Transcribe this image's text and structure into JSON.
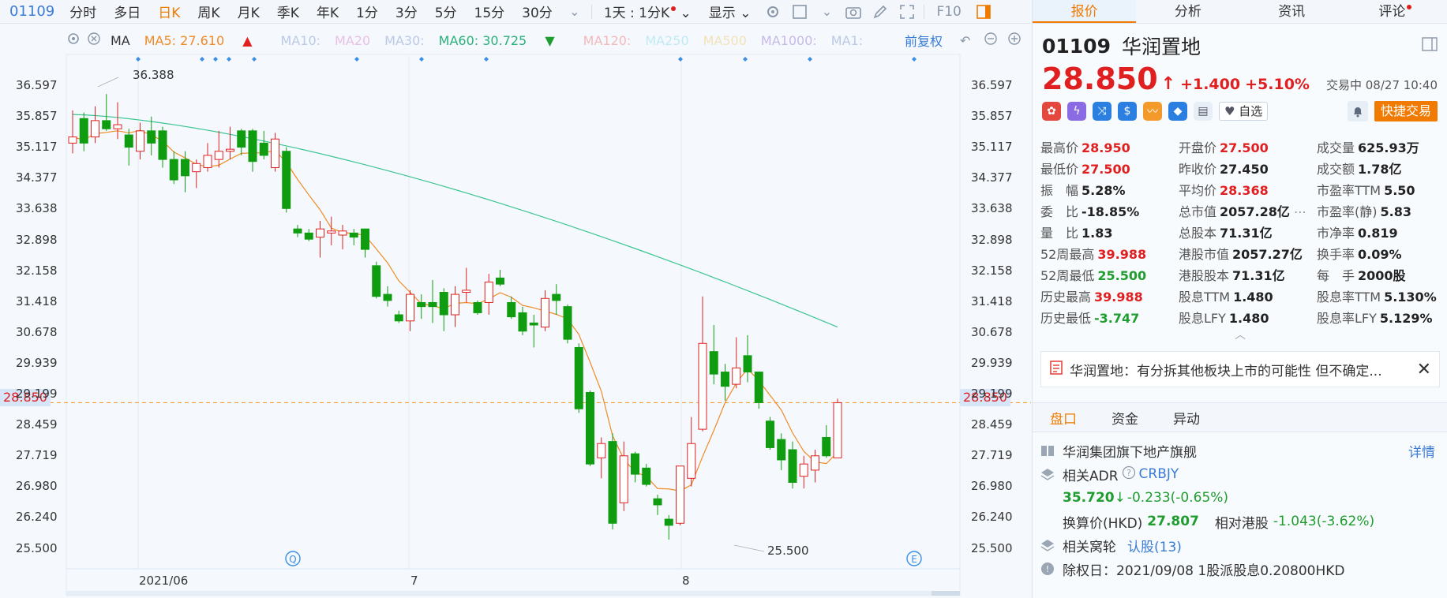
{
  "toolbar": {
    "code": "01109",
    "items": [
      "分时",
      "多日",
      "日K",
      "周K",
      "月K",
      "季K",
      "年K",
      "1分",
      "3分",
      "5分",
      "15分",
      "30分"
    ],
    "active": "日K",
    "period_select": "1天 : 1分K",
    "display_label": "显示",
    "f10": "F10"
  },
  "ma": {
    "label": "MA",
    "ma5": "MA5: 27.610",
    "ma10": "MA10:",
    "ma20": "MA20",
    "ma30": "MA30:",
    "ma60": "MA60: 30.725",
    "ma120": "MA120:",
    "ma250": "MA250",
    "ma500": "MA500",
    "ma1000": "MA1000:",
    "ma1": "MA1:",
    "fq": "前复权",
    "colors": {
      "ma5": "#f08a24",
      "ma60": "#2cb07a",
      "faded": "#b9c9e6"
    }
  },
  "chart": {
    "y_ticks": [
      "36.597",
      "35.857",
      "35.117",
      "34.377",
      "33.638",
      "32.898",
      "32.158",
      "31.418",
      "30.678",
      "29.939",
      "29.199",
      "28.459",
      "27.719",
      "26.980",
      "26.240",
      "25.500"
    ],
    "current_price": "28.850",
    "high_label": "36.388",
    "low_label": "25.500",
    "x_labels": [
      "2021/06",
      "7",
      "8"
    ],
    "marker_q": "Q",
    "marker_e": "E"
  },
  "chart_data": {
    "type": "candlestick",
    "ylim": [
      25.5,
      36.597
    ],
    "candles": [
      {
        "o": 35.2,
        "h": 36.0,
        "l": 34.95,
        "c": 35.35
      },
      {
        "o": 35.8,
        "h": 35.95,
        "l": 35.0,
        "c": 35.2
      },
      {
        "o": 35.35,
        "h": 36.1,
        "l": 35.2,
        "c": 35.75
      },
      {
        "o": 35.75,
        "h": 36.4,
        "l": 35.5,
        "c": 35.55
      },
      {
        "o": 35.55,
        "h": 36.2,
        "l": 35.3,
        "c": 35.65
      },
      {
        "o": 35.4,
        "h": 35.55,
        "l": 34.65,
        "c": 35.1
      },
      {
        "o": 35.0,
        "h": 35.7,
        "l": 34.8,
        "c": 35.5
      },
      {
        "o": 35.5,
        "h": 35.85,
        "l": 34.9,
        "c": 35.2
      },
      {
        "o": 35.5,
        "h": 35.6,
        "l": 34.6,
        "c": 34.8
      },
      {
        "o": 34.8,
        "h": 35.0,
        "l": 34.2,
        "c": 34.3
      },
      {
        "o": 34.8,
        "h": 35.0,
        "l": 34.0,
        "c": 34.4
      },
      {
        "o": 34.5,
        "h": 34.8,
        "l": 34.1,
        "c": 34.7
      },
      {
        "o": 34.6,
        "h": 35.2,
        "l": 34.5,
        "c": 34.9
      },
      {
        "o": 34.8,
        "h": 35.5,
        "l": 34.6,
        "c": 35.0
      },
      {
        "o": 35.0,
        "h": 35.6,
        "l": 34.8,
        "c": 35.05
      },
      {
        "o": 35.5,
        "h": 35.55,
        "l": 34.9,
        "c": 35.1
      },
      {
        "o": 35.5,
        "h": 35.55,
        "l": 34.5,
        "c": 34.75
      },
      {
        "o": 35.2,
        "h": 35.5,
        "l": 34.8,
        "c": 34.9
      },
      {
        "o": 34.6,
        "h": 35.45,
        "l": 34.5,
        "c": 35.3
      },
      {
        "o": 35.0,
        "h": 35.1,
        "l": 33.5,
        "c": 33.6
      },
      {
        "o": 33.1,
        "h": 33.2,
        "l": 32.9,
        "c": 33.0
      },
      {
        "o": 33.0,
        "h": 33.1,
        "l": 32.8,
        "c": 32.85
      },
      {
        "o": 32.9,
        "h": 33.3,
        "l": 32.4,
        "c": 33.1
      },
      {
        "o": 33.0,
        "h": 33.4,
        "l": 32.7,
        "c": 33.05
      },
      {
        "o": 32.95,
        "h": 33.2,
        "l": 32.6,
        "c": 33.05
      },
      {
        "o": 33.0,
        "h": 33.1,
        "l": 32.7,
        "c": 32.9
      },
      {
        "o": 33.1,
        "h": 33.1,
        "l": 32.4,
        "c": 32.6
      },
      {
        "o": 32.2,
        "h": 32.3,
        "l": 31.4,
        "c": 31.45
      },
      {
        "o": 31.5,
        "h": 31.7,
        "l": 31.2,
        "c": 31.35
      },
      {
        "o": 31.0,
        "h": 31.1,
        "l": 30.8,
        "c": 30.85
      },
      {
        "o": 30.85,
        "h": 31.6,
        "l": 30.6,
        "c": 31.5
      },
      {
        "o": 31.3,
        "h": 31.5,
        "l": 30.9,
        "c": 31.2
      },
      {
        "o": 31.3,
        "h": 31.85,
        "l": 30.8,
        "c": 31.2
      },
      {
        "o": 31.55,
        "h": 31.65,
        "l": 30.6,
        "c": 31.0
      },
      {
        "o": 31.0,
        "h": 31.7,
        "l": 30.7,
        "c": 31.5
      },
      {
        "o": 31.55,
        "h": 32.15,
        "l": 31.3,
        "c": 31.6
      },
      {
        "o": 31.3,
        "h": 31.35,
        "l": 31.0,
        "c": 31.05
      },
      {
        "o": 31.3,
        "h": 32.0,
        "l": 31.0,
        "c": 31.8
      },
      {
        "o": 31.9,
        "h": 32.1,
        "l": 31.7,
        "c": 31.75
      },
      {
        "o": 31.3,
        "h": 31.45,
        "l": 30.9,
        "c": 30.95
      },
      {
        "o": 31.05,
        "h": 31.2,
        "l": 30.5,
        "c": 30.6
      },
      {
        "o": 30.8,
        "h": 31.0,
        "l": 30.2,
        "c": 30.75
      },
      {
        "o": 30.7,
        "h": 31.6,
        "l": 30.6,
        "c": 31.4
      },
      {
        "o": 31.5,
        "h": 31.75,
        "l": 31.0,
        "c": 31.35
      },
      {
        "o": 31.2,
        "h": 31.25,
        "l": 30.3,
        "c": 30.4
      },
      {
        "o": 30.2,
        "h": 30.3,
        "l": 28.6,
        "c": 28.7
      },
      {
        "o": 29.1,
        "h": 29.15,
        "l": 27.3,
        "c": 27.35
      },
      {
        "o": 27.5,
        "h": 28.0,
        "l": 27.0,
        "c": 27.85
      },
      {
        "o": 27.9,
        "h": 28.1,
        "l": 25.75,
        "c": 25.9
      },
      {
        "o": 26.4,
        "h": 27.9,
        "l": 26.2,
        "c": 27.55
      },
      {
        "o": 27.6,
        "h": 27.65,
        "l": 26.9,
        "c": 27.1
      },
      {
        "o": 27.25,
        "h": 27.35,
        "l": 26.8,
        "c": 26.85
      },
      {
        "o": 26.5,
        "h": 26.6,
        "l": 26.1,
        "c": 26.35
      },
      {
        "o": 26.0,
        "h": 26.1,
        "l": 25.5,
        "c": 25.85
      },
      {
        "o": 25.9,
        "h": 27.3,
        "l": 25.85,
        "c": 27.3
      },
      {
        "o": 27.0,
        "h": 28.5,
        "l": 26.8,
        "c": 27.85
      },
      {
        "o": 28.2,
        "h": 31.45,
        "l": 28.15,
        "c": 30.3
      },
      {
        "o": 30.1,
        "h": 30.75,
        "l": 29.3,
        "c": 29.55
      },
      {
        "o": 29.6,
        "h": 29.8,
        "l": 28.9,
        "c": 29.25
      },
      {
        "o": 29.3,
        "h": 30.45,
        "l": 29.2,
        "c": 29.7
      },
      {
        "o": 30.0,
        "h": 30.5,
        "l": 29.35,
        "c": 29.6
      },
      {
        "o": 29.6,
        "h": 29.6,
        "l": 28.7,
        "c": 28.85
      },
      {
        "o": 28.4,
        "h": 28.5,
        "l": 27.7,
        "c": 27.75
      },
      {
        "o": 27.95,
        "h": 28.1,
        "l": 27.2,
        "c": 27.45
      },
      {
        "o": 27.7,
        "h": 27.9,
        "l": 26.75,
        "c": 26.9
      },
      {
        "o": 27.05,
        "h": 27.55,
        "l": 26.75,
        "c": 27.35
      },
      {
        "o": 27.2,
        "h": 27.7,
        "l": 26.9,
        "c": 27.55
      },
      {
        "o": 28.0,
        "h": 28.3,
        "l": 27.5,
        "c": 27.55
      },
      {
        "o": 27.5,
        "h": 28.95,
        "l": 27.5,
        "c": 28.85
      }
    ]
  },
  "right": {
    "tabs": [
      "报价",
      "分析",
      "资讯",
      "评论"
    ],
    "code": "01109",
    "name": "华润置地",
    "price": "28.850",
    "change": "+1.400",
    "change_pct": "+5.10%",
    "status": "交易中 08/27 10:40",
    "fav": "自选",
    "quick_trade": "快捷交易",
    "quotes": [
      [
        [
          "最高价",
          "28.950",
          "red"
        ],
        [
          "开盘价",
          "27.500",
          "red"
        ],
        [
          "成交量",
          "625.93万",
          "dark"
        ]
      ],
      [
        [
          "最低价",
          "27.500",
          "red"
        ],
        [
          "昨收价",
          "27.450",
          "dark"
        ],
        [
          "成交额",
          "1.78亿",
          "dark"
        ]
      ],
      [
        [
          "振　幅",
          "5.28%",
          "dark"
        ],
        [
          "平均价",
          "28.368",
          "red"
        ],
        [
          "市盈率TTM",
          "5.50",
          "dark"
        ]
      ],
      [
        [
          "委　比",
          "-18.85%",
          "dark"
        ],
        [
          "总市值",
          "2057.28亿",
          "dark"
        ],
        [
          "市盈率(静)",
          "5.83",
          "dark"
        ]
      ],
      [
        [
          "量　比",
          "1.83",
          "dark"
        ],
        [
          "总股本",
          "71.31亿",
          "dark"
        ],
        [
          "市净率",
          "0.819",
          "dark"
        ]
      ],
      [
        [
          "52周最高",
          "39.988",
          "red"
        ],
        [
          "港股市值",
          "2057.27亿",
          "dark"
        ],
        [
          "换手率",
          "0.09%",
          "dark"
        ]
      ],
      [
        [
          "52周最低",
          "25.500",
          "green"
        ],
        [
          "港股股本",
          "71.31亿",
          "dark"
        ],
        [
          "每　手",
          "2000股",
          "dark"
        ]
      ],
      [
        [
          "历史最高",
          "39.988",
          "red"
        ],
        [
          "股息TTM",
          "1.480",
          "dark"
        ],
        [
          "股息率TTM",
          "5.130%",
          "dark"
        ]
      ],
      [
        [
          "历史最低",
          "-3.747",
          "green"
        ],
        [
          "股息LFY",
          "1.480",
          "dark"
        ],
        [
          "股息率LFY",
          "5.129%",
          "dark"
        ]
      ]
    ],
    "news": "华润置地：有分拆其他板块上市的可能性 但不确定...",
    "subtabs": [
      "盘口",
      "资金",
      "异动"
    ],
    "group": "华润集团旗下地产旗舰",
    "detail": "详情",
    "adr_label": "相关ADR",
    "adr_code": "CRBJY",
    "adr_price": "35.720",
    "adr_change": "-0.233(-0.65%)",
    "conv_label": "换算价(HKD)",
    "conv_price": "27.807",
    "rel_label": "相对港股",
    "rel_value": "-1.043(-3.62%)",
    "warrant_label": "相关窝轮",
    "warrant_link": "认股(13)",
    "dividend": "除权日：2021/09/08  1股派股息0.20800HKD"
  }
}
